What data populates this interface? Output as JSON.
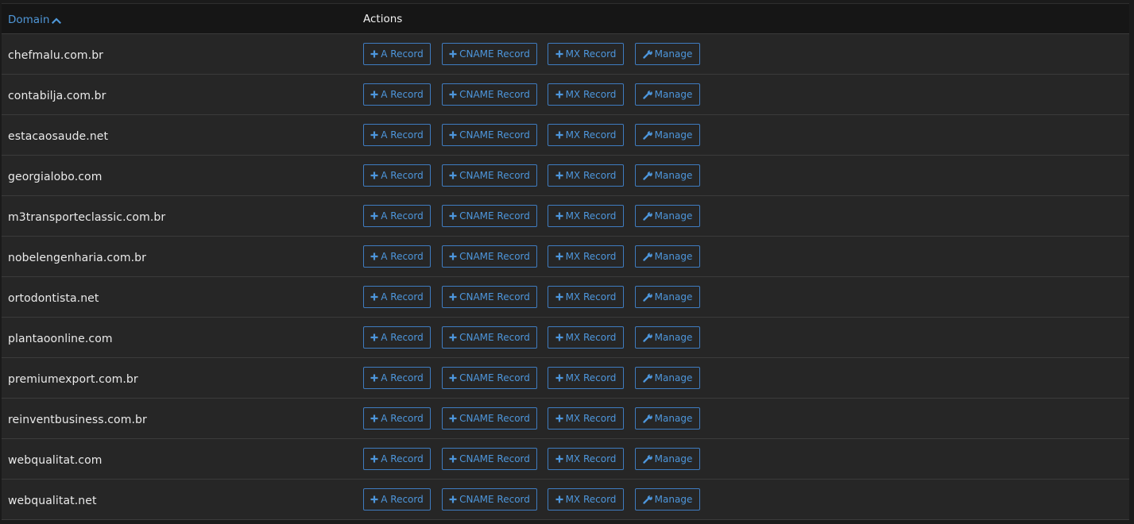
{
  "table": {
    "header": {
      "domain_label": "Domain",
      "sort_icon": "chevron-up-icon",
      "actions_label": "Actions"
    },
    "action_labels": {
      "a_record": "A Record",
      "cname_record": "CNAME Record",
      "mx_record": "MX Record",
      "manage": "Manage"
    },
    "action_icons": {
      "add": "plus-icon",
      "manage": "wrench-icon"
    },
    "rows": [
      {
        "domain": "chefmalu.com.br"
      },
      {
        "domain": "contabilja.com.br"
      },
      {
        "domain": "estacaosaude.net"
      },
      {
        "domain": "georgialobo.com"
      },
      {
        "domain": "m3transporteclassic.com.br"
      },
      {
        "domain": "nobelengenharia.com.br"
      },
      {
        "domain": "ortodontista.net"
      },
      {
        "domain": "plantaoonline.com"
      },
      {
        "domain": "premiumexport.com.br"
      },
      {
        "domain": "reinventbusiness.com.br"
      },
      {
        "domain": "webqualitat.com"
      },
      {
        "domain": "webqualitat.net"
      }
    ]
  },
  "colors": {
    "accent": "#4d96dc",
    "background": "#1b1b1b",
    "row_background": "#262626"
  }
}
